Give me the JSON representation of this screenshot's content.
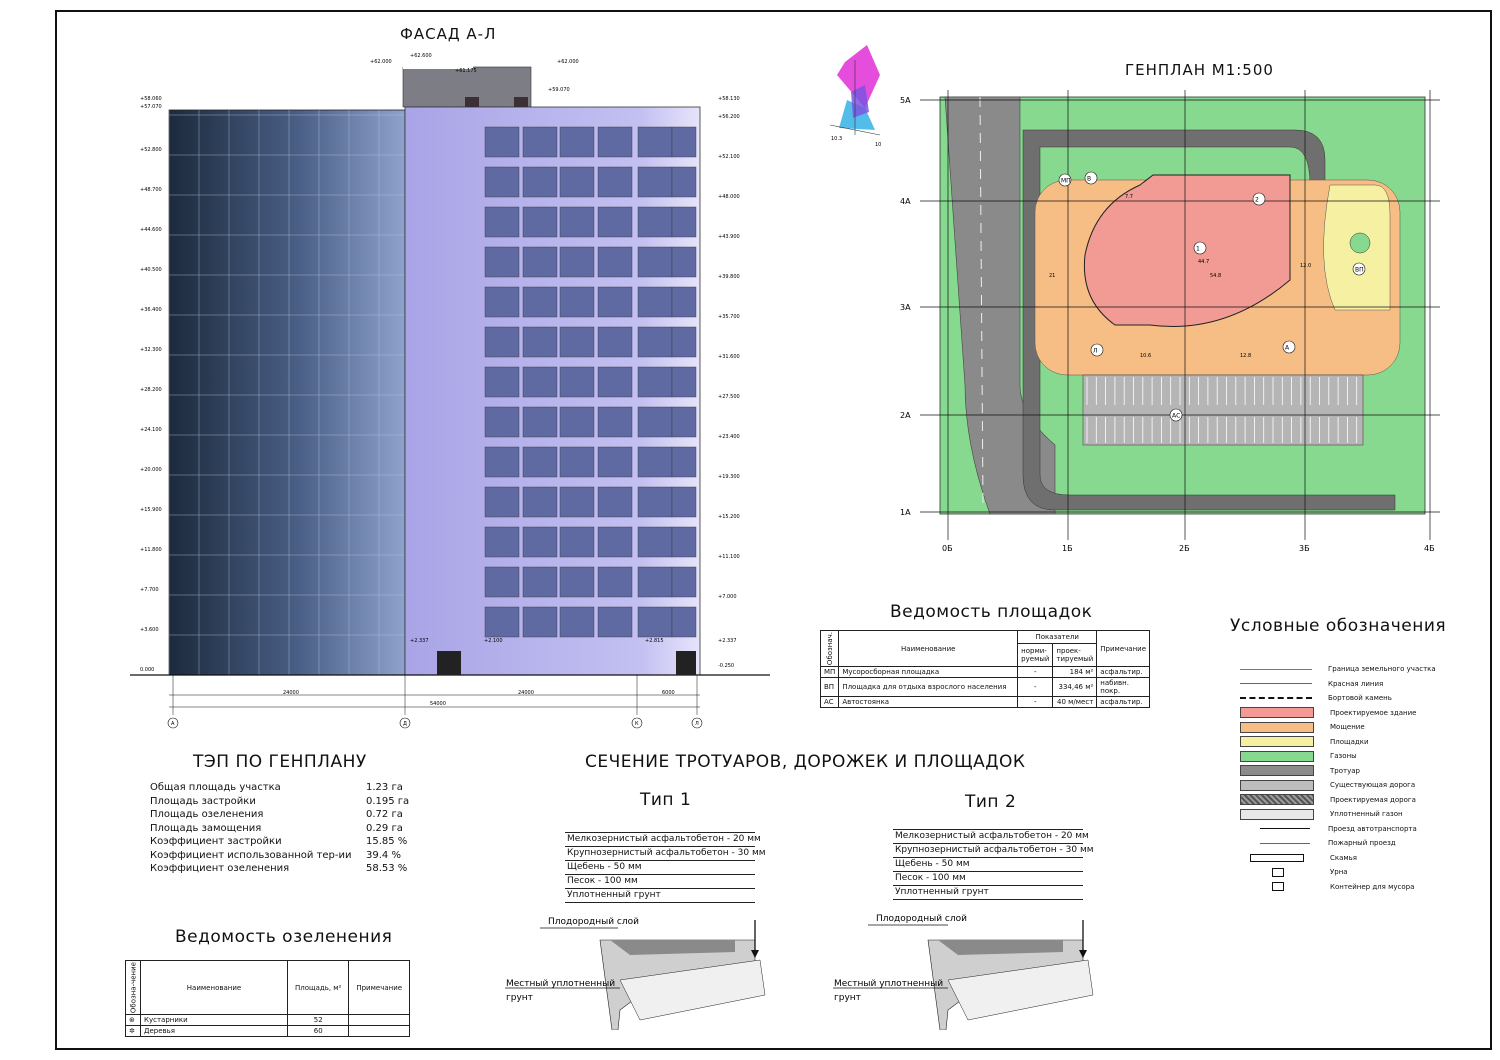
{
  "facade": {
    "title": "ФАСАД А-Л",
    "left_marks": [
      "+58.060",
      "+57.070",
      "+52.800",
      "+48.700",
      "+44.600",
      "+40.500",
      "+36.400",
      "+32.300",
      "+28.200",
      "+24.100",
      "+20.000",
      "+15.900",
      "+11.800",
      "+7.700",
      "+3.600",
      "0.000"
    ],
    "right_marks": [
      "+58.130",
      "+56.200",
      "+52.100",
      "+48.000",
      "+43.900",
      "+39.800",
      "+35.700",
      "+31.600",
      "+27.500",
      "+23.400",
      "+19.300",
      "+15.200",
      "+11.100",
      "+7.000",
      "+2.337",
      "-0.250"
    ],
    "top_marks": [
      "+62.000",
      "+62.600",
      "+61.175",
      "+62.000",
      "+59.070"
    ],
    "entry_marks": [
      "+2.337",
      "+2.100",
      "+2.815"
    ],
    "dims": [
      "24000",
      "24000",
      "6000",
      "54000"
    ],
    "axes": [
      "А",
      "Д",
      "К",
      "Л"
    ]
  },
  "genplan": {
    "title": "ГЕНПЛАН М1:500",
    "rows": [
      "5А",
      "4А",
      "3А",
      "2А",
      "1А"
    ],
    "cols": [
      "0Б",
      "1Б",
      "2Б",
      "3Б",
      "4Б"
    ],
    "labels": [
      "МП",
      "В",
      "1",
      "2",
      "Л",
      "А",
      "ВП",
      "АС"
    ],
    "dims": [
      "7.7",
      "44.7",
      "54.8",
      "21",
      "12.0",
      "10.6",
      "12.8"
    ],
    "compass": [
      "10.3",
      "10"
    ]
  },
  "sites": {
    "title": "Ведомость площадок",
    "headers": [
      "Обознач.",
      "Наименование",
      "Показатели",
      "норми-руемый",
      "проек-тируемый",
      "Примечание"
    ],
    "rows": [
      {
        "code": "МП",
        "name": "Мусоросборная площадка",
        "norm": "-",
        "proj": "184 м²",
        "note": "асфальтир."
      },
      {
        "code": "ВП",
        "name": "Площадка для отдыха взрослого населения",
        "norm": "-",
        "proj": "334,46 м²",
        "note": "набивн. покр."
      },
      {
        "code": "АС",
        "name": "Автостоянка",
        "norm": "-",
        "proj": "40 м/мест",
        "note": "асфальтир."
      }
    ]
  },
  "legend": {
    "title": "Условные обозначения",
    "items": [
      {
        "label": "Граница земельного участка",
        "color": "#b14fc5",
        "kind": "line"
      },
      {
        "label": "Красная линия",
        "color": "#e03030",
        "kind": "line"
      },
      {
        "label": "Бортовой камень",
        "color": "#111111",
        "kind": "dash"
      },
      {
        "label": "Проектируемое здание",
        "color": "#f29a94",
        "kind": "fill"
      },
      {
        "label": "Мощение",
        "color": "#f6bd84",
        "kind": "fill"
      },
      {
        "label": "Площадки",
        "color": "#f6f0a2",
        "kind": "fill"
      },
      {
        "label": "Газоны",
        "color": "#86d98e",
        "kind": "fill"
      },
      {
        "label": "Тротуар",
        "color": "#8c8c8c",
        "kind": "fill"
      },
      {
        "label": "Существующая дорога",
        "color": "#bdbdbd",
        "kind": "fill"
      },
      {
        "label": "Проектируемая дорога",
        "color": "#6e6e6e",
        "kind": "hatch"
      },
      {
        "label": "Уплотненный газон",
        "color": "#e8e8e8",
        "kind": "fill"
      },
      {
        "label": "Проезд автотранспорта",
        "color": "#111111",
        "kind": "arrow"
      },
      {
        "label": "Пожарный проезд",
        "color": "#e03030",
        "kind": "arrow"
      },
      {
        "label": "Скамья",
        "color": "#111111",
        "kind": "bench"
      },
      {
        "label": "Урна",
        "color": "#111111",
        "kind": "box"
      },
      {
        "label": "Контейнер для мусора",
        "color": "#111111",
        "kind": "box"
      }
    ]
  },
  "tep": {
    "title": "ТЭП ПО ГЕНПЛАНУ",
    "rows": [
      {
        "name": "Общая площадь участка",
        "value": "1.23 га"
      },
      {
        "name": "Площадь застройки",
        "value": "0.195 га"
      },
      {
        "name": "Площадь озеленения",
        "value": "0.72 га"
      },
      {
        "name": "Площадь замощения",
        "value": "0.29 га"
      },
      {
        "name": "Коэффициент застройки",
        "value": "15.85 %"
      },
      {
        "name": "Коэффициент использованной тер-ии",
        "value": "39.4 %"
      },
      {
        "name": "Коэффициент озеленения",
        "value": "58.53 %"
      }
    ]
  },
  "greenery": {
    "title": "Ведомость озеленения",
    "headers": [
      "Обозна-чение",
      "Наименование",
      "Площадь, м²",
      "Примечание"
    ],
    "rows": [
      {
        "name": "Кустарники",
        "value": "52"
      },
      {
        "name": "Деревья",
        "value": "60"
      }
    ]
  },
  "section": {
    "title": "СЕЧЕНИЕ ТРОТУАРОВ, ДОРОЖЕК И ПЛОЩАДОК",
    "type1": "Тип 1",
    "type2": "Тип 2",
    "layers": [
      "Мелкозернистый асфальтобетон - 20 мм",
      "Крупнозернистый асфальтобетон - 30 мм",
      "Щебень - 50 мм",
      "Песок - 100 мм",
      "Уплотненный грунт"
    ],
    "topsoil": "Плодородный слой",
    "local_soil_1": "Местный уплотненный",
    "local_soil_2": "грунт"
  }
}
